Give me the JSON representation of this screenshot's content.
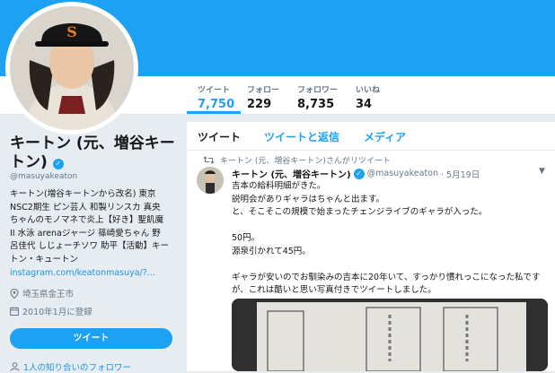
{
  "profile": {
    "name": "キートン (元、増谷キートン)",
    "handle": "@masuyakeaton",
    "bio_lines": [
      "キートン(増谷キートンから改名) 東京",
      "NSC2期生 ピン芸人 和製リンスカ 真央",
      "ちゃんのモノマネで炎上【好き】聖飢魔",
      "II 水泳 arenaジャージ 篠崎愛ちゃん 野",
      "呂佳代 しじょーチソワ 助平【活動】キー",
      "トン・キュートン"
    ],
    "link": "instagram.com/keatonmasuya/?...",
    "location": "埼玉県金王市",
    "joined": "2010年1月に登録",
    "tweet_button": "ツイート",
    "mutual": "1人の知り合いのフォロワー"
  },
  "stats": [
    {
      "label": "ツイート",
      "value": "7,750"
    },
    {
      "label": "フォロー",
      "value": "229"
    },
    {
      "label": "フォロワー",
      "value": "8,735"
    },
    {
      "label": "いいね",
      "value": "34"
    }
  ],
  "tabs": [
    "ツイート",
    "ツイートと返信",
    "メディア"
  ],
  "tweet": {
    "retweet_label": "キートン (元、増谷キートン)さんがリツイート",
    "author": "キートン (元、増谷キートン)",
    "handle": "@masuyakeaton",
    "date": "· 5月19日",
    "lines": [
      "吉本の給料明細がきた。",
      "説明会がありギャラはちゃんと出ます。",
      "と、そこそこの規模で始まったチェンジライブのギャラが入った。",
      "",
      "50円。",
      "源泉引かれて45円。",
      "",
      "ギャラが安いのでお馴染みの吉本に20年いて、すっかり慣れっこになった私です",
      "が、これは酷いと思い写真付きでツイートしました。"
    ]
  },
  "colors": {
    "accent": "#1da1f2",
    "link": "#1b95e0",
    "muted": "#657786",
    "background": "#e6ecf0"
  },
  "icons": {
    "verified": "verified-badge-icon",
    "location": "map-pin-icon",
    "calendar": "calendar-icon",
    "retweet": "retweet-icon",
    "caret": "chevron-down-icon",
    "mutual": "followers-icon"
  }
}
